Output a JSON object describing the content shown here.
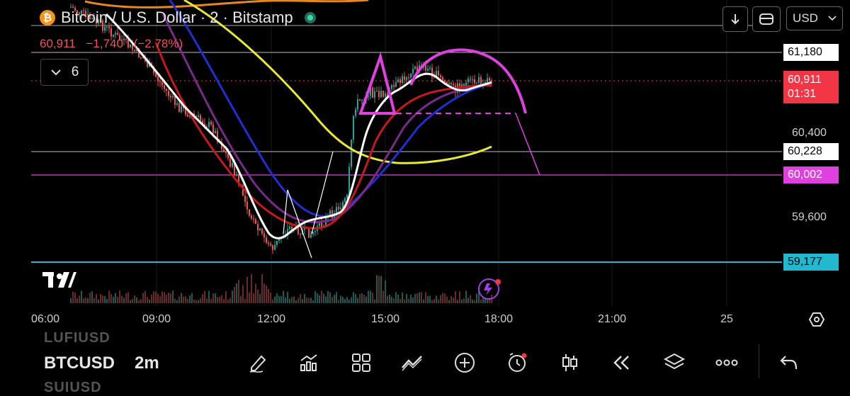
{
  "header": {
    "title": "Bitcoin / U.S. Dollar · 2 · Bitstamp",
    "price": "60,911",
    "change_abs": "−1,740",
    "change_pct": "(−2.78%)",
    "indicators_count": "6",
    "currency": "USD"
  },
  "price_axis": {
    "labels": [
      "60,400",
      "59,600"
    ],
    "tags": {
      "high": "61,180",
      "current": "60,911",
      "countdown": "01:31",
      "level_1": "60,228",
      "level_2": "60,002",
      "low": "59,177"
    }
  },
  "time_axis": {
    "labels": [
      "06:00",
      "09:00",
      "12:00",
      "15:00",
      "18:00",
      "21:00",
      "25"
    ]
  },
  "bottom_bar": {
    "symbol_prev": "LUFIUSD",
    "symbol": "BTCUSD",
    "symbol_next": "SUIUSD",
    "interval": "2m",
    "tools": [
      "pencil-icon",
      "indicators-icon",
      "grid-icon",
      "drawing-icon",
      "add-icon",
      "alert-icon",
      "candles-icon",
      "replay-icon",
      "layers-icon",
      "more-icon",
      "undo-icon"
    ]
  },
  "colors": {
    "up": "#26a69a",
    "down": "#ef5350",
    "accent": "#e040e0",
    "brand": "#f7931a",
    "cyan": "#22b8cf"
  }
}
